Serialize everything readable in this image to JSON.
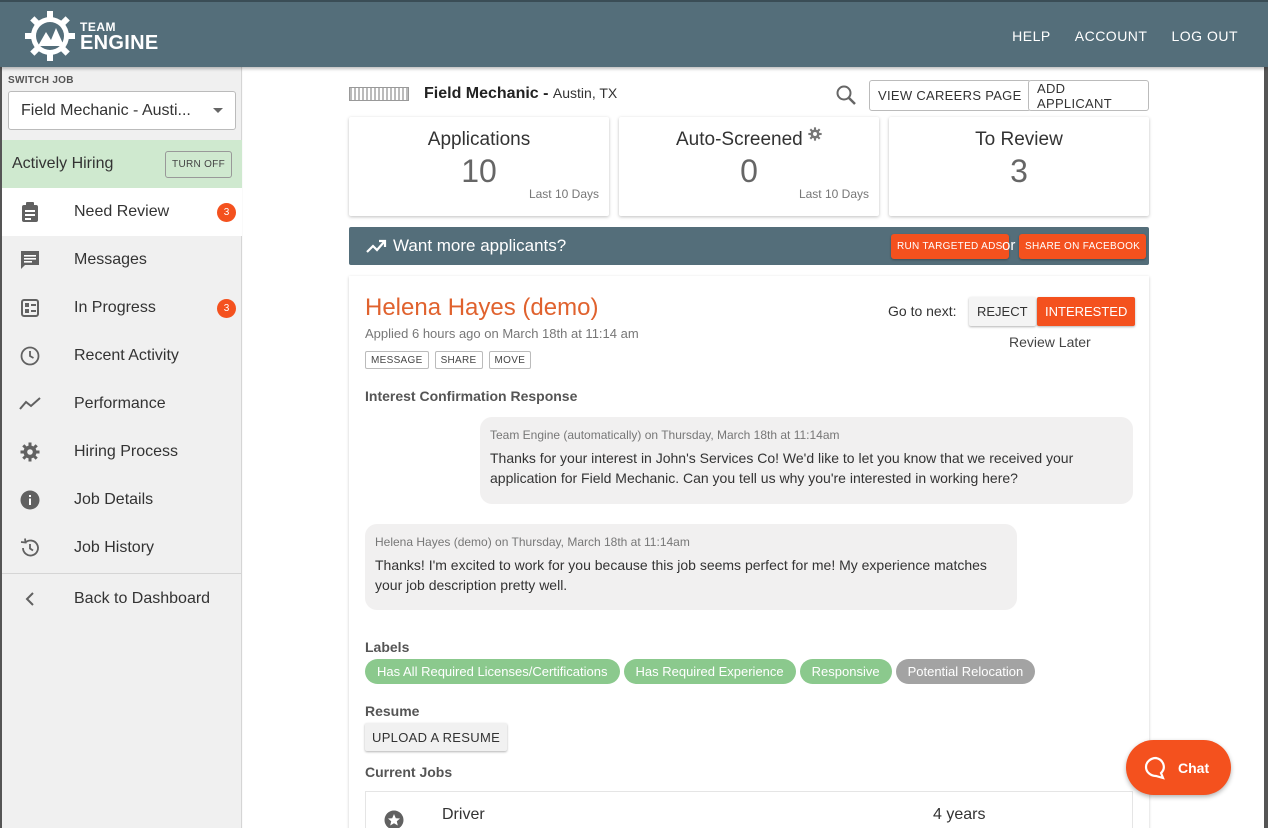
{
  "header": {
    "logo_line1": "TEAM",
    "logo_line2": "ENGINE",
    "nav": [
      "HELP",
      "ACCOUNT",
      "LOG OUT"
    ]
  },
  "sidebar": {
    "switch_label": "SWITCH JOB",
    "selected_job": "Field Mechanic - Austi...",
    "hiring_status": "Actively Hiring",
    "turn_off": "TURN OFF",
    "items": [
      {
        "label": "Need Review",
        "icon": "clipboard-icon",
        "badge": "3"
      },
      {
        "label": "Messages",
        "icon": "message-icon"
      },
      {
        "label": "In Progress",
        "icon": "checklist-icon",
        "badge": "3"
      },
      {
        "label": "Recent Activity",
        "icon": "clock-icon"
      },
      {
        "label": "Performance",
        "icon": "trend-icon"
      },
      {
        "label": "Hiring Process",
        "icon": "gear-icon"
      },
      {
        "label": "Job Details",
        "icon": "info-icon"
      },
      {
        "label": "Job History",
        "icon": "history-icon"
      }
    ],
    "back": "Back to Dashboard"
  },
  "job_header": {
    "title": "Field Mechanic - ",
    "location": "Austin, TX",
    "view_careers": "VIEW CAREERS PAGE",
    "add_applicant": "ADD APPLICANT"
  },
  "stats": [
    {
      "title": "Applications",
      "value": "10",
      "sub": "Last 10 Days"
    },
    {
      "title": "Auto-Screened",
      "value": "0",
      "sub": "Last 10 Days"
    },
    {
      "title": "To Review",
      "value": "3",
      "sub": ""
    }
  ],
  "promo": {
    "text": "Want more applicants?",
    "ads": "RUN TARGETED ADS",
    "or": "or",
    "facebook": "SHARE ON FACEBOOK"
  },
  "applicant": {
    "name": "Helena Hayes (demo)",
    "applied": "Applied 6 hours ago on March 18th at 11:14 am",
    "actions": [
      "MESSAGE",
      "SHARE",
      "MOVE"
    ],
    "go_to_next": "Go to next:",
    "reject": "REJECT",
    "interested": "INTERESTED",
    "review_later": "Review Later",
    "confirmation_heading": "Interest Confirmation Response",
    "msg1_meta": "Team Engine (automatically) on Thursday, March 18th at 11:14am",
    "msg1_text": "Thanks for your interest in John's Services Co! We'd like to let you know that we received your application for Field Mechanic. Can you tell us why you're interested in working here?",
    "msg2_meta": "Helena Hayes (demo) on Thursday, March 18th at 11:14am",
    "msg2_text": "Thanks! I'm excited to work for you because this job seems perfect for me! My experience matches your job description pretty well.",
    "labels_heading": "Labels",
    "labels": [
      {
        "text": "Has All Required Licenses/Certifications",
        "color": "#8bc98d"
      },
      {
        "text": "Has Required Experience",
        "color": "#8bc98d"
      },
      {
        "text": "Responsive",
        "color": "#8bc98d"
      },
      {
        "text": "Potential Relocation",
        "color": "#a3a3a3"
      }
    ],
    "resume_heading": "Resume",
    "upload_resume": "UPLOAD A RESUME",
    "current_jobs_heading": "Current Jobs",
    "current_job": {
      "title": "Driver",
      "duration": "4 years"
    }
  },
  "chat": {
    "label": "Chat"
  },
  "colors": {
    "accent": "#f4511e",
    "header": "#546e7a",
    "hiring": "#cfe9cf"
  }
}
